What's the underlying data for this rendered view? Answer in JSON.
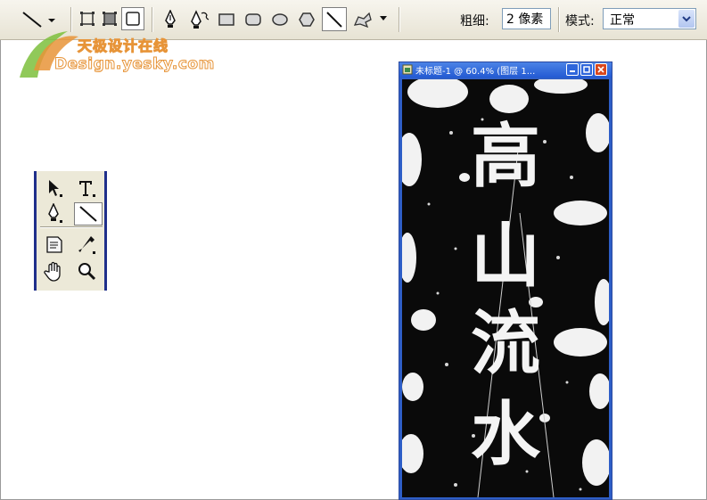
{
  "options_bar": {
    "weight_label": "粗细:",
    "weight_value": "2 像素",
    "mode_label": "模式:",
    "mode_value": "正常"
  },
  "watermark": {
    "chinese": "天极设计在线",
    "english": "Design.yesky.com"
  },
  "document_window": {
    "title": "未标题-1 @ 60.4% (图层 1...",
    "artwork_characters": [
      "高",
      "山",
      "流",
      "水"
    ]
  },
  "colors": {
    "window_blue": "#2e5ec7",
    "palette_border": "#1f2f8b",
    "watermark_orange": "#e79438",
    "watermark_green": "#7cbf3c"
  }
}
